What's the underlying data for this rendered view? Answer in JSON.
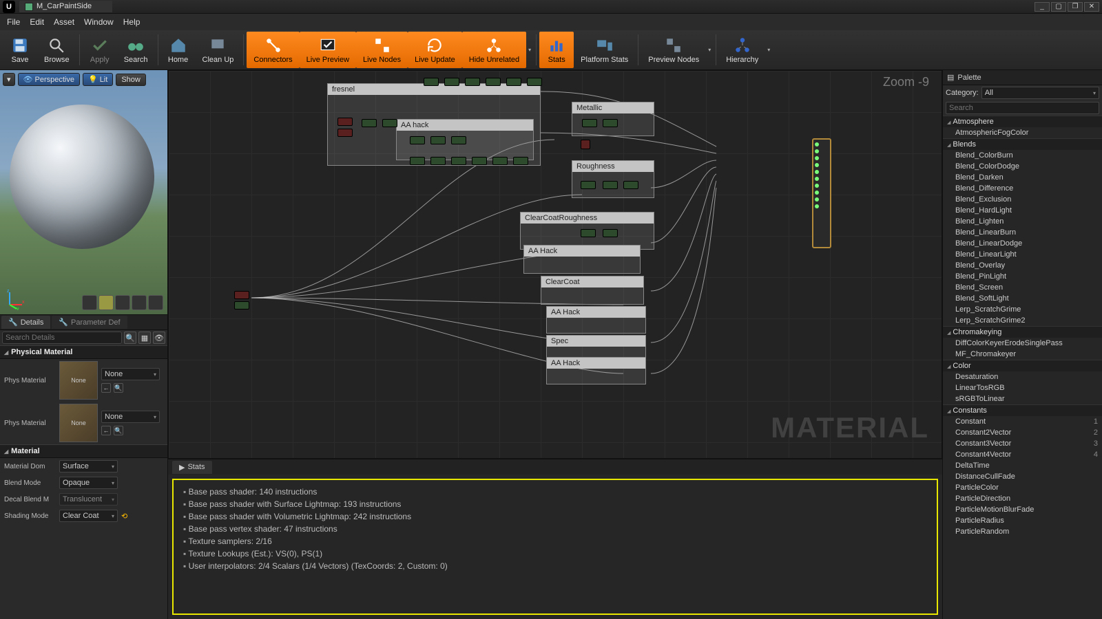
{
  "title": "M_CarPaintSide",
  "menubar": [
    "File",
    "Edit",
    "Asset",
    "Window",
    "Help"
  ],
  "toolbar": [
    {
      "id": "save",
      "label": "Save"
    },
    {
      "id": "browse",
      "label": "Browse"
    },
    {
      "id": "apply",
      "label": "Apply"
    },
    {
      "id": "search",
      "label": "Search"
    },
    {
      "id": "home",
      "label": "Home"
    },
    {
      "id": "cleanup",
      "label": "Clean Up"
    },
    {
      "id": "connectors",
      "label": "Connectors",
      "hl": true
    },
    {
      "id": "livepreview",
      "label": "Live Preview",
      "hl": true
    },
    {
      "id": "livenodes",
      "label": "Live Nodes",
      "hl": true
    },
    {
      "id": "liveupdate",
      "label": "Live Update",
      "hl": true
    },
    {
      "id": "hideunrelated",
      "label": "Hide Unrelated",
      "hl": true,
      "drop": true
    },
    {
      "id": "stats",
      "label": "Stats",
      "hl": true
    },
    {
      "id": "platformstats",
      "label": "Platform Stats"
    },
    {
      "id": "previewnodes",
      "label": "Preview Nodes",
      "drop": true
    },
    {
      "id": "hierarchy",
      "label": "Hierarchy",
      "drop": true
    }
  ],
  "viewport": {
    "perspective": "Perspective",
    "lit": "Lit",
    "show": "Show"
  },
  "tabs": {
    "details": "Details",
    "paramdef": "Parameter Def"
  },
  "detailsSearch": "Search Details",
  "sections": {
    "physmat": "Physical Material",
    "material": "Material"
  },
  "detailRows": {
    "physMaterial": "Phys Material",
    "none": "None",
    "materialDom": "Material Dom",
    "surface": "Surface",
    "blendMode": "Blend Mode",
    "opaque": "Opaque",
    "decalBlend": "Decal Blend M",
    "translucent": "Translucent",
    "shadingMode": "Shading Mode",
    "clearCoat": "Clear Coat"
  },
  "graph": {
    "zoom": "Zoom -9",
    "watermark": "MATERIAL",
    "comments": {
      "fresnel": "fresnel",
      "aahack": "AA hack",
      "metallic": "Metallic",
      "roughness": "Roughness",
      "ccrough": "ClearCoatRoughness",
      "aahack2": "AA Hack",
      "clearcoat": "ClearCoat",
      "aahack3": "AA Hack",
      "spec": "Spec",
      "aahack4": "AA Hack"
    }
  },
  "statsTab": "Stats",
  "stats": [
    "Base pass shader: 140 instructions",
    "Base pass shader with Surface Lightmap: 193 instructions",
    "Base pass shader with Volumetric Lightmap: 242 instructions",
    "Base pass vertex shader: 47 instructions",
    "Texture samplers: 2/16",
    "Texture Lookups (Est.): VS(0), PS(1)",
    "User interpolators: 2/4 Scalars (1/4 Vectors) (TexCoords: 2, Custom: 0)"
  ],
  "palette": {
    "title": "Palette",
    "categoryLabel": "Category:",
    "categoryValue": "All",
    "search": "Search",
    "groups": [
      {
        "name": "Atmosphere",
        "items": [
          {
            "n": "AtmosphericFogColor"
          }
        ]
      },
      {
        "name": "Blends",
        "items": [
          {
            "n": "Blend_ColorBurn"
          },
          {
            "n": "Blend_ColorDodge"
          },
          {
            "n": "Blend_Darken"
          },
          {
            "n": "Blend_Difference"
          },
          {
            "n": "Blend_Exclusion"
          },
          {
            "n": "Blend_HardLight"
          },
          {
            "n": "Blend_Lighten"
          },
          {
            "n": "Blend_LinearBurn"
          },
          {
            "n": "Blend_LinearDodge"
          },
          {
            "n": "Blend_LinearLight"
          },
          {
            "n": "Blend_Overlay"
          },
          {
            "n": "Blend_PinLight"
          },
          {
            "n": "Blend_Screen"
          },
          {
            "n": "Blend_SoftLight"
          },
          {
            "n": "Lerp_ScratchGrime"
          },
          {
            "n": "Lerp_ScratchGrime2"
          }
        ]
      },
      {
        "name": "Chromakeying",
        "items": [
          {
            "n": "DiffColorKeyerErodeSinglePass"
          },
          {
            "n": "MF_Chromakeyer"
          }
        ]
      },
      {
        "name": "Color",
        "items": [
          {
            "n": "Desaturation"
          },
          {
            "n": "LinearTosRGB"
          },
          {
            "n": "sRGBToLinear"
          }
        ]
      },
      {
        "name": "Constants",
        "items": [
          {
            "n": "Constant",
            "k": "1"
          },
          {
            "n": "Constant2Vector",
            "k": "2"
          },
          {
            "n": "Constant3Vector",
            "k": "3"
          },
          {
            "n": "Constant4Vector",
            "k": "4"
          },
          {
            "n": "DeltaTime"
          },
          {
            "n": "DistanceCullFade"
          },
          {
            "n": "ParticleColor"
          },
          {
            "n": "ParticleDirection"
          },
          {
            "n": "ParticleMotionBlurFade"
          },
          {
            "n": "ParticleRadius"
          },
          {
            "n": "ParticleRandom"
          }
        ]
      }
    ]
  }
}
